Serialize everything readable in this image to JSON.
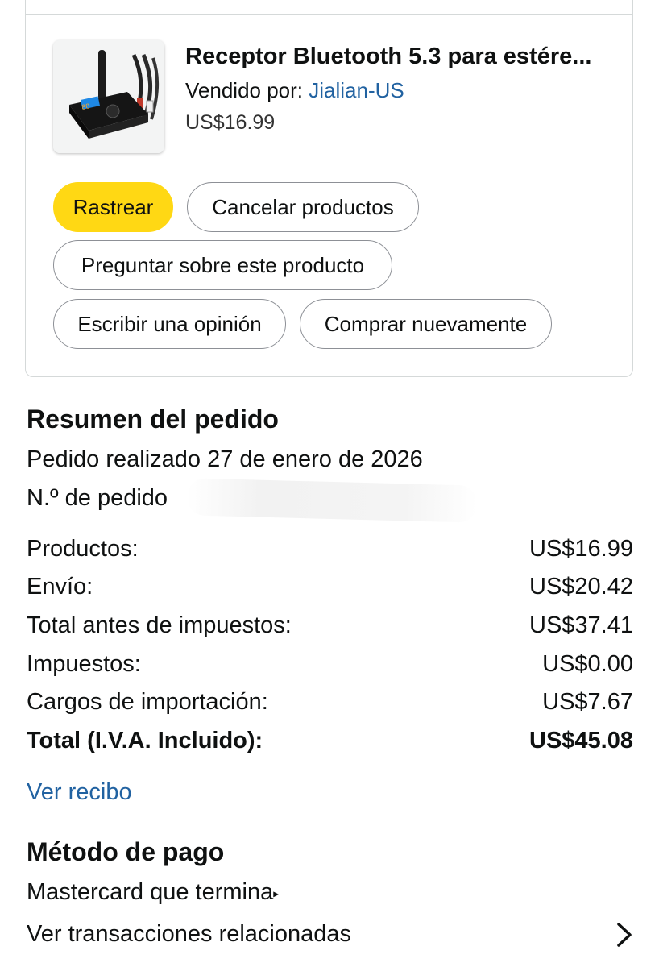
{
  "product": {
    "title": "Receptor Bluetooth 5.3 para estére...",
    "sold_by_label": "Vendido por:",
    "seller": "Jialian-US",
    "price": "US$16.99",
    "image_icon": "bluetooth-receiver-image"
  },
  "actions": {
    "track": "Rastrear",
    "cancel": "Cancelar productos",
    "ask": "Preguntar sobre este producto",
    "review": "Escribir una opinión",
    "buy_again": "Comprar nuevamente"
  },
  "summary": {
    "title": "Resumen del pedido",
    "placed": "Pedido realizado 27 de enero de 2026",
    "order_number_label": "N.º de pedido",
    "rows": [
      {
        "label": "Productos:",
        "value": "US$16.99"
      },
      {
        "label": "Envío:",
        "value": "US$20.42"
      },
      {
        "label": "Total antes de impuestos:",
        "value": "US$37.41"
      },
      {
        "label": "Impuestos:",
        "value": "US$0.00"
      },
      {
        "label": "Cargos de importación:",
        "value": "US$7.67"
      },
      {
        "label": "Total (I.V.A. Incluido):",
        "value": "US$45.08"
      }
    ],
    "receipt_link": "Ver recibo"
  },
  "payment": {
    "title": "Método de pago",
    "card": "Mastercard  que termina",
    "transactions": "Ver transacciones relacionadas"
  },
  "colors": {
    "accent_yellow": "#ffd814",
    "link_blue": "#2162a1"
  }
}
